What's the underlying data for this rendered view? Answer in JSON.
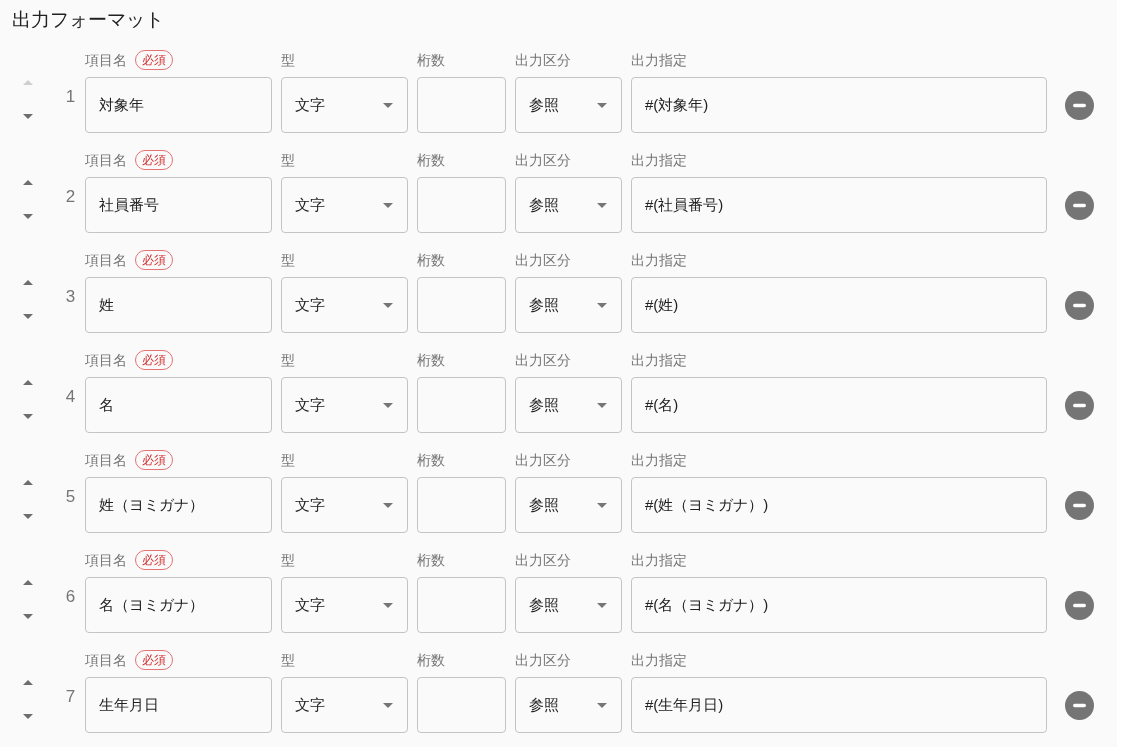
{
  "title": "出力フォーマット",
  "rows": [
    {
      "number": "1",
      "move_up_disabled": true,
      "move_down_disabled": false,
      "name": {
        "label": "項目名",
        "badge": "必須",
        "value": "対象年"
      },
      "type": {
        "label": "型",
        "value": "文字"
      },
      "digits": {
        "label": "桁数"
      },
      "output_type": {
        "label": "出力区分",
        "value": "参照"
      },
      "output_spec": {
        "label": "出力指定",
        "value": "#(対象年)"
      }
    },
    {
      "number": "2",
      "move_up_disabled": false,
      "move_down_disabled": false,
      "name": {
        "label": "項目名",
        "badge": "必須",
        "value": "社員番号"
      },
      "type": {
        "label": "型",
        "value": "文字"
      },
      "digits": {
        "label": "桁数"
      },
      "output_type": {
        "label": "出力区分",
        "value": "参照"
      },
      "output_spec": {
        "label": "出力指定",
        "value": "#(社員番号)"
      }
    },
    {
      "number": "3",
      "move_up_disabled": false,
      "move_down_disabled": false,
      "name": {
        "label": "項目名",
        "badge": "必須",
        "value": "姓"
      },
      "type": {
        "label": "型",
        "value": "文字"
      },
      "digits": {
        "label": "桁数"
      },
      "output_type": {
        "label": "出力区分",
        "value": "参照"
      },
      "output_spec": {
        "label": "出力指定",
        "value": "#(姓)"
      }
    },
    {
      "number": "4",
      "move_up_disabled": false,
      "move_down_disabled": false,
      "name": {
        "label": "項目名",
        "badge": "必須",
        "value": "名"
      },
      "type": {
        "label": "型",
        "value": "文字"
      },
      "digits": {
        "label": "桁数"
      },
      "output_type": {
        "label": "出力区分",
        "value": "参照"
      },
      "output_spec": {
        "label": "出力指定",
        "value": "#(名)"
      }
    },
    {
      "number": "5",
      "move_up_disabled": false,
      "move_down_disabled": false,
      "name": {
        "label": "項目名",
        "badge": "必須",
        "value": "姓（ヨミガナ）"
      },
      "type": {
        "label": "型",
        "value": "文字"
      },
      "digits": {
        "label": "桁数"
      },
      "output_type": {
        "label": "出力区分",
        "value": "参照"
      },
      "output_spec": {
        "label": "出力指定",
        "value": "#(姓（ヨミガナ）)"
      }
    },
    {
      "number": "6",
      "move_up_disabled": false,
      "move_down_disabled": false,
      "name": {
        "label": "項目名",
        "badge": "必須",
        "value": "名（ヨミガナ）"
      },
      "type": {
        "label": "型",
        "value": "文字"
      },
      "digits": {
        "label": "桁数"
      },
      "output_type": {
        "label": "出力区分",
        "value": "参照"
      },
      "output_spec": {
        "label": "出力指定",
        "value": "#(名（ヨミガナ）)"
      }
    },
    {
      "number": "7",
      "move_up_disabled": false,
      "move_down_disabled": false,
      "name": {
        "label": "項目名",
        "badge": "必須",
        "value": "生年月日"
      },
      "type": {
        "label": "型",
        "value": "文字"
      },
      "digits": {
        "label": "桁数"
      },
      "output_type": {
        "label": "出力区分",
        "value": "参照"
      },
      "output_spec": {
        "label": "出力指定",
        "value": "#(生年月日)"
      }
    }
  ]
}
